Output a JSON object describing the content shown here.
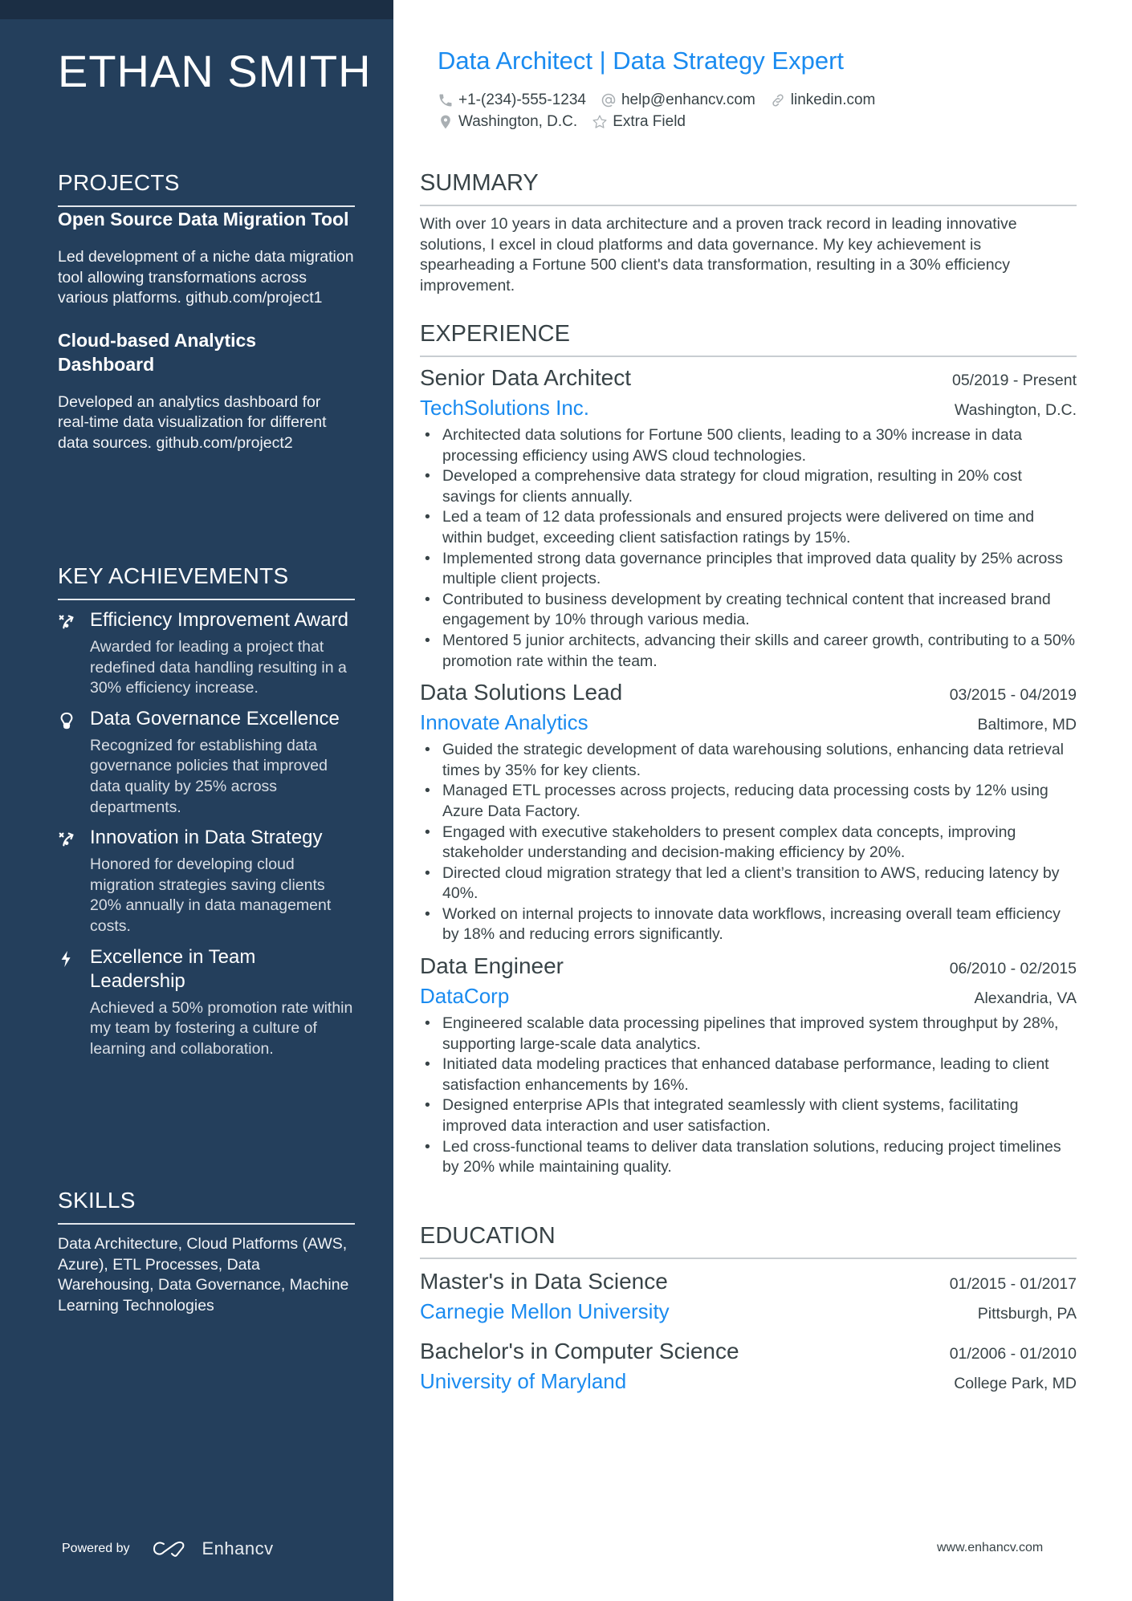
{
  "sidebar": {
    "name": "ETHAN SMITH",
    "projects": {
      "title": "PROJECTS",
      "items": [
        {
          "title": "Open Source Data Migration Tool",
          "description": "Led development of a niche data migration tool allowing transformations across various platforms. github.com/project1"
        },
        {
          "title": "Cloud-based Analytics Dashboard",
          "description": "Developed an analytics dashboard for real-time data visualization for different data sources. github.com/project2"
        }
      ]
    },
    "achievements": {
      "title": "KEY ACHIEVEMENTS",
      "items": [
        {
          "icon": "strategy-arrow-icon",
          "title": "Efficiency Improvement Award",
          "description": "Awarded for leading a project that redefined data handling resulting in a 30% efficiency increase."
        },
        {
          "icon": "lightbulb-icon",
          "title": "Data Governance Excellence",
          "description": "Recognized for establishing data governance policies that improved data quality by 25% across departments."
        },
        {
          "icon": "strategy-arrow-icon",
          "title": "Innovation in Data Strategy",
          "description": "Honored for developing cloud migration strategies saving clients 20% annually in data management costs."
        },
        {
          "icon": "lightning-bolt-icon",
          "title": "Excellence in Team Leadership",
          "description": "Achieved a 50% promotion rate within my team by fostering a culture of learning and collaboration."
        }
      ]
    },
    "skills": {
      "title": "SKILLS",
      "text": "Data Architecture, Cloud Platforms (AWS, Azure), ETL Processes, Data Warehousing, Data Governance, Machine Learning Technologies"
    },
    "footer": {
      "powered_by": "Powered by",
      "brand": "Enhancv"
    }
  },
  "header": {
    "headline": "Data Architect | Data Strategy Expert",
    "contacts": {
      "phone": {
        "icon": "phone-icon",
        "value": "+1-(234)-555-1234"
      },
      "email": {
        "icon": "at-sign-icon",
        "value": "help@enhancv.com"
      },
      "link": {
        "icon": "link-icon",
        "value": "linkedin.com"
      },
      "location": {
        "icon": "location-pin-icon",
        "value": "Washington, D.C."
      },
      "extra": {
        "icon": "star-icon",
        "value": "Extra Field"
      }
    }
  },
  "summary": {
    "title": "SUMMARY",
    "text": "With over 10 years in data architecture and a proven track record in leading innovative solutions, I excel in cloud platforms and data governance. My key achievement is spearheading a Fortune 500 client's data transformation, resulting in a 30% efficiency improvement."
  },
  "experience": {
    "title": "EXPERIENCE",
    "jobs": [
      {
        "title": "Senior Data Architect",
        "dates": "05/2019 - Present",
        "company": "TechSolutions Inc.",
        "location": "Washington, D.C.",
        "bullets": [
          "Architected data solutions for Fortune 500 clients, leading to a 30% increase in data processing efficiency using AWS cloud technologies.",
          "Developed a comprehensive data strategy for cloud migration, resulting in 20% cost savings for clients annually.",
          "Led a team of 12 data professionals and ensured projects were delivered on time and within budget, exceeding client satisfaction ratings by 15%.",
          "Implemented strong data governance principles that improved data quality by 25% across multiple client projects.",
          "Contributed to business development by creating technical content that increased brand engagement by 10% through various media.",
          "Mentored 5 junior architects, advancing their skills and career growth, contributing to a 50% promotion rate within the team."
        ]
      },
      {
        "title": "Data Solutions Lead",
        "dates": "03/2015 - 04/2019",
        "company": "Innovate Analytics",
        "location": "Baltimore, MD",
        "bullets": [
          "Guided the strategic development of data warehousing solutions, enhancing data retrieval times by 35% for key clients.",
          "Managed ETL processes across projects, reducing data processing costs by 12% using Azure Data Factory.",
          "Engaged with executive stakeholders to present complex data concepts, improving stakeholder understanding and decision-making efficiency by 20%.",
          "Directed cloud migration strategy that led a client’s transition to AWS, reducing latency by 40%.",
          "Worked on internal projects to innovate data workflows, increasing overall team efficiency by 18% and reducing errors significantly."
        ]
      },
      {
        "title": "Data Engineer",
        "dates": "06/2010 - 02/2015",
        "company": "DataCorp",
        "location": "Alexandria, VA",
        "bullets": [
          "Engineered scalable data processing pipelines that improved system throughput by 28%, supporting large-scale data analytics.",
          "Initiated data modeling practices that enhanced database performance, leading to client satisfaction enhancements by 16%.",
          "Designed enterprise APIs that integrated seamlessly with client systems, facilitating improved data interaction and user satisfaction.",
          "Led cross-functional teams to deliver data translation solutions, reducing project timelines by 20% while maintaining quality."
        ]
      }
    ]
  },
  "education": {
    "title": "EDUCATION",
    "items": [
      {
        "degree": "Master's in Data Science",
        "dates": "01/2015 - 01/2017",
        "school": "Carnegie Mellon University",
        "location": "Pittsburgh, PA"
      },
      {
        "degree": "Bachelor's in Computer Science",
        "dates": "01/2006 - 01/2010",
        "school": "University of Maryland",
        "location": "College Park, MD"
      }
    ]
  },
  "footer": {
    "website": "www.enhancv.com"
  },
  "colors": {
    "sidebar_bg": "#243f5c",
    "sidebar_topbar": "#1b2e44",
    "accent": "#1a8bf0",
    "text": "#384347"
  }
}
